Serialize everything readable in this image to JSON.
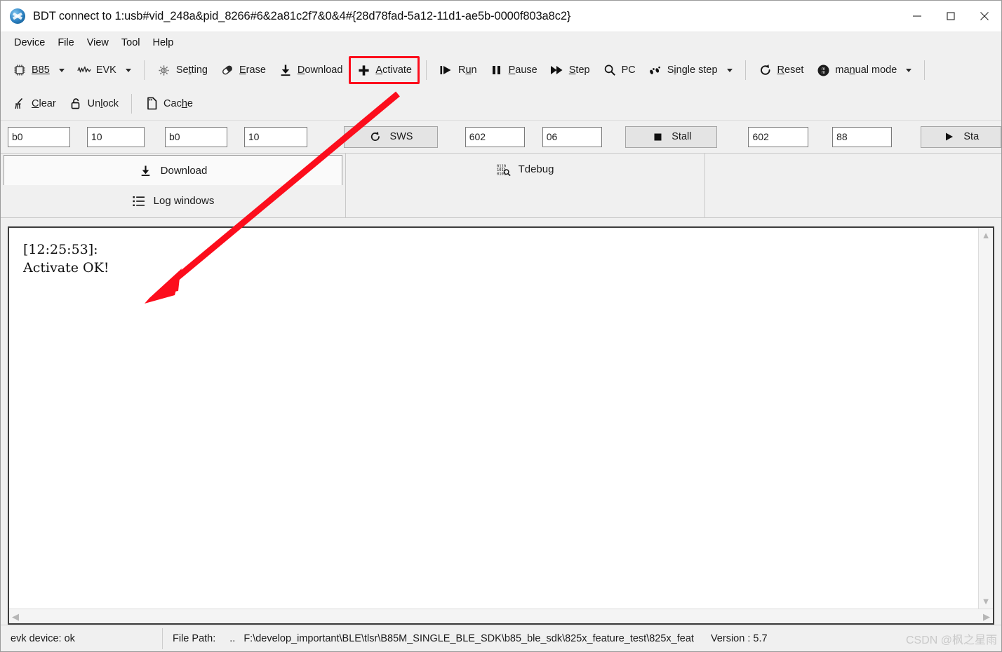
{
  "window": {
    "title": "BDT connect to 1:usb#vid_248a&pid_8266#6&2a81c2f7&0&4#{28d78fad-5a12-11d1-ae5b-0000f803a8c2}",
    "app_icon": "bdt-app-icon",
    "controls": {
      "minimize": "minimize-icon",
      "maximize": "maximize-icon",
      "close": "close-icon"
    }
  },
  "menubar": {
    "items": [
      {
        "label": "Device"
      },
      {
        "label": "File"
      },
      {
        "label": "View"
      },
      {
        "label": "Tool"
      },
      {
        "label": "Help"
      }
    ]
  },
  "toolbar_row1": {
    "chip_select": {
      "label": "B85",
      "icon": "chip-icon"
    },
    "board_select": {
      "label": "EVK",
      "icon": "waveform-icon"
    },
    "setting": {
      "label": "Setting",
      "icon": "gear-icon"
    },
    "erase": {
      "label": "Erase",
      "icon": "eraser-icon"
    },
    "download": {
      "label": "Download",
      "icon": "download-arrow-icon"
    },
    "activate": {
      "label": "Activate",
      "icon": "plus-icon",
      "highlight_color": "#fc0d1c"
    },
    "run": {
      "label": "Run",
      "icon": "play-step-icon"
    },
    "pause": {
      "label": "Pause",
      "icon": "pause-icon"
    },
    "step": {
      "label": "Step",
      "icon": "fast-forward-icon"
    },
    "pc": {
      "label": "PC",
      "icon": "magnifier-icon"
    },
    "single_step": {
      "label": "Single step",
      "icon": "footsteps-icon"
    },
    "reset": {
      "label": "Reset",
      "icon": "refresh-icon"
    },
    "mode_select": {
      "label": "manual mode",
      "icon": "mm-circle-icon"
    }
  },
  "toolbar_row2": {
    "clear": {
      "label": "Clear",
      "icon": "broom-icon"
    },
    "unlock": {
      "label": "Unlock",
      "icon": "unlock-icon"
    },
    "cache": {
      "label": "Cache",
      "icon": "sdcard-icon"
    }
  },
  "fieldrow": {
    "addr1": {
      "value": "b0",
      "placeholder": ""
    },
    "len1": {
      "value": "10",
      "placeholder": ""
    },
    "addr2": {
      "value": "b0",
      "placeholder": ""
    },
    "len2": {
      "value": "10",
      "placeholder": ""
    },
    "sws_button": {
      "label": "SWS",
      "icon": "refresh-icon"
    },
    "sws_addr": {
      "value": "602",
      "placeholder": ""
    },
    "sws_data": {
      "value": "06",
      "placeholder": ""
    },
    "stall_button": {
      "label": "Stall",
      "icon": "stop-square-icon"
    },
    "stall_addr": {
      "value": "602",
      "placeholder": ""
    },
    "stall_data": {
      "value": "88",
      "placeholder": ""
    },
    "start_button": {
      "label": "Sta",
      "icon": "play-icon"
    }
  },
  "tabs": {
    "left": [
      {
        "label": "Download",
        "icon": "download-arrow-icon",
        "active": true
      },
      {
        "label": "Log windows",
        "icon": "list-icon",
        "active": false
      }
    ],
    "middle": [
      {
        "label": "Tdebug",
        "icon": "binary-magnifier-icon",
        "active": false
      }
    ]
  },
  "log": {
    "lines": "[12:25:53]:\nActivate OK!",
    "scroll": {
      "up": "chevron-up-icon",
      "down": "chevron-down-icon",
      "left": "chevron-left-icon",
      "right": "chevron-right-icon"
    }
  },
  "statusbar": {
    "device": "evk device: ok",
    "file_path_label": "File Path:",
    "file_path_prefix": "..",
    "file_path": "F:\\develop_important\\BLE\\tlsr\\B85M_SINGLE_BLE_SDK\\b85_ble_sdk\\825x_feature_test\\825x_feat",
    "version": "Version : 5.7",
    "watermark": "CSDN @枫之星雨"
  },
  "annotation": {
    "arrow_color": "#fc0d1c",
    "description": "red-arrow-pointing-from-activate-button-to-log"
  }
}
